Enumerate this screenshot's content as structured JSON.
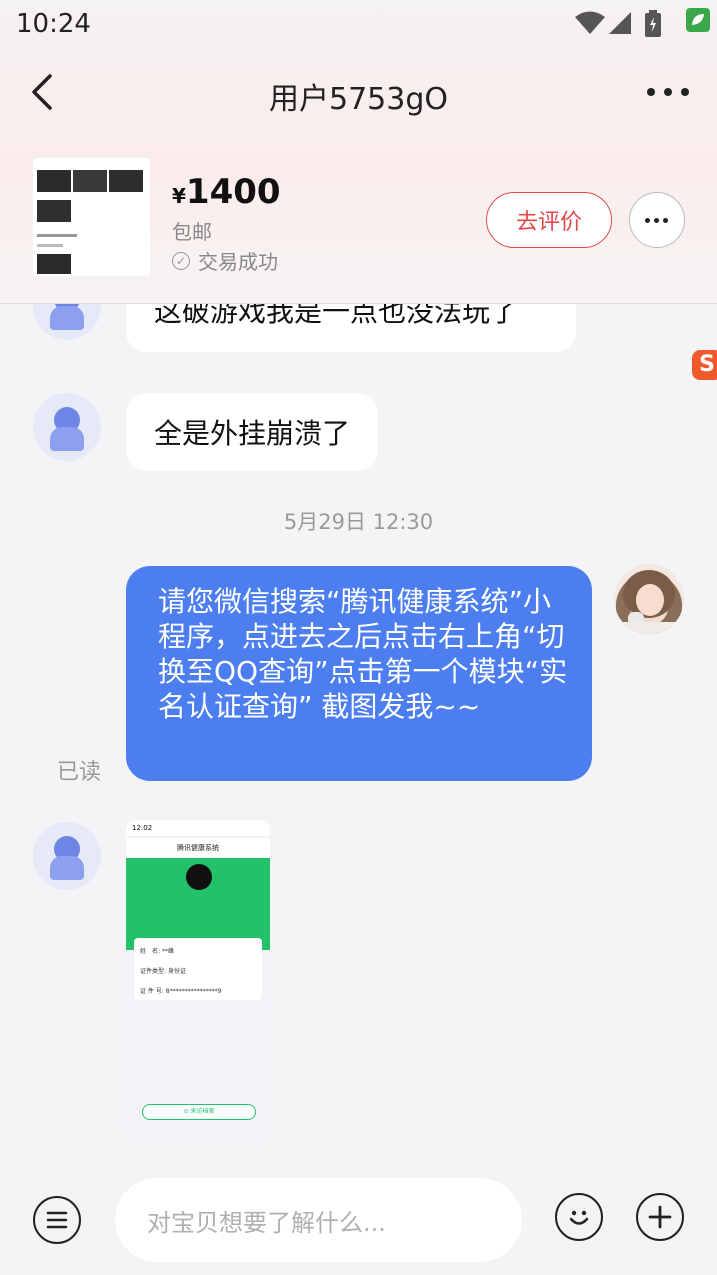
{
  "status_bar": {
    "time": "10:24"
  },
  "header": {
    "title": "用户5753gO"
  },
  "product": {
    "currency": "¥",
    "price": "1400",
    "shipping": "包邮",
    "deal_status": "交易成功",
    "rate_button": "去评价"
  },
  "messages": {
    "partial_incoming": "这破游戏我是一点也没法玩了",
    "incoming_1": "全是外挂崩溃了",
    "timestamp": "5月29日 12:30",
    "outgoing_1": "请您微信搜索“腾讯健康系统”小程序，点进去之后点击右上角“切换至QQ查询”点击第一个模块“实名认证查询” 截图发我~~",
    "read_status": "已读"
  },
  "shared_image": {
    "time": "12:02",
    "title": "腾讯健康系统",
    "row1_label": "姓　名:",
    "row1_value": "**峰",
    "row2_label": "证件类型:",
    "row2_value": "身份证",
    "row3_label": "证 件 号:",
    "row3_value": "8****************9",
    "button": "⊙ 来访档案"
  },
  "input_bar": {
    "placeholder": "对宝贝想要了解什么..."
  },
  "colors": {
    "accent_red": "#e0484a",
    "bubble_blue": "#4d7ef0",
    "mini_green": "#23c169"
  },
  "icons": [
    "back-icon",
    "more-icon",
    "check-circle-icon",
    "menu-icon",
    "emoji-icon",
    "plus-icon",
    "wifi-icon",
    "signal-icon",
    "battery-icon"
  ]
}
